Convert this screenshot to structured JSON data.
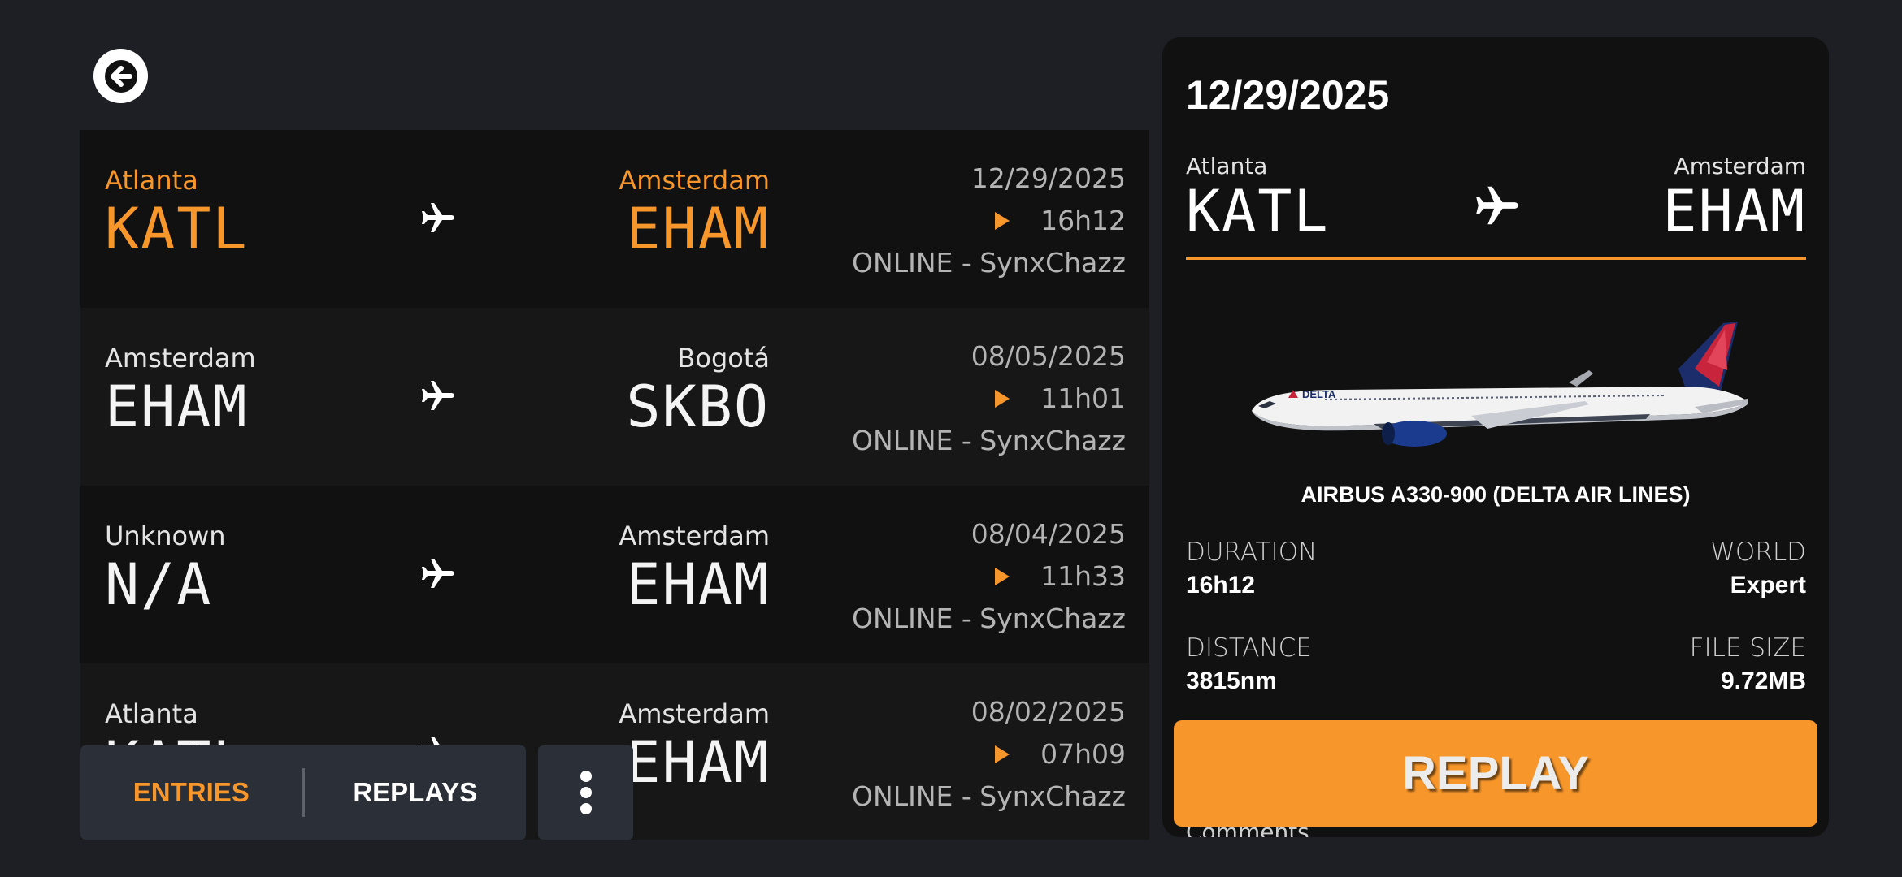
{
  "flights": [
    {
      "from_city": "Atlanta",
      "from_code": "KATL",
      "to_city": "Amsterdam",
      "to_code": "EHAM",
      "date": "12/29/2025",
      "duration": "16h12",
      "session": "ONLINE - SynxChazz",
      "selected": true
    },
    {
      "from_city": "Amsterdam",
      "from_code": "EHAM",
      "to_city": "Bogotá",
      "to_code": "SKBO",
      "date": "08/05/2025",
      "duration": "11h01",
      "session": "ONLINE - SynxChazz"
    },
    {
      "from_city": "Unknown",
      "from_code": "N/A",
      "to_city": "Amsterdam",
      "to_code": "EHAM",
      "date": "08/04/2025",
      "duration": "11h33",
      "session": "ONLINE - SynxChazz"
    },
    {
      "from_city": "Atlanta",
      "from_code": "KATL",
      "to_city": "Amsterdam",
      "to_code": "EHAM",
      "date": "08/02/2025",
      "duration": "07h09",
      "session": "ONLINE - SynxChazz"
    }
  ],
  "tabs": {
    "entries": "ENTRIES",
    "replays": "REPLAYS"
  },
  "detail": {
    "date": "12/29/2025",
    "from_city": "Atlanta",
    "from_code": "KATL",
    "to_city": "Amsterdam",
    "to_code": "EHAM",
    "aircraft": "AIRBUS A330-900 (DELTA AIR LINES)",
    "duration_label": "DURATION",
    "duration": "16h12",
    "world_label": "WORLD",
    "world": "Expert",
    "distance_label": "DISTANCE",
    "distance": "3815nm",
    "filesize_label": "FILE SIZE",
    "filesize": "9.72MB",
    "replay_label": "REPLAY",
    "comments_label": "Comments",
    "livery_logo_text": "DELTA"
  },
  "colors": {
    "accent": "#f7962a",
    "background": "#1d1f24",
    "row_dark": "#111111",
    "row_light": "#171717",
    "panel": "#111111",
    "tabbar": "#2b2f37"
  },
  "icons": {
    "back": "arrow-left-circle-icon",
    "plane": "airplane-icon",
    "play": "play-triangle-icon",
    "more": "vertical-dots-icon"
  }
}
